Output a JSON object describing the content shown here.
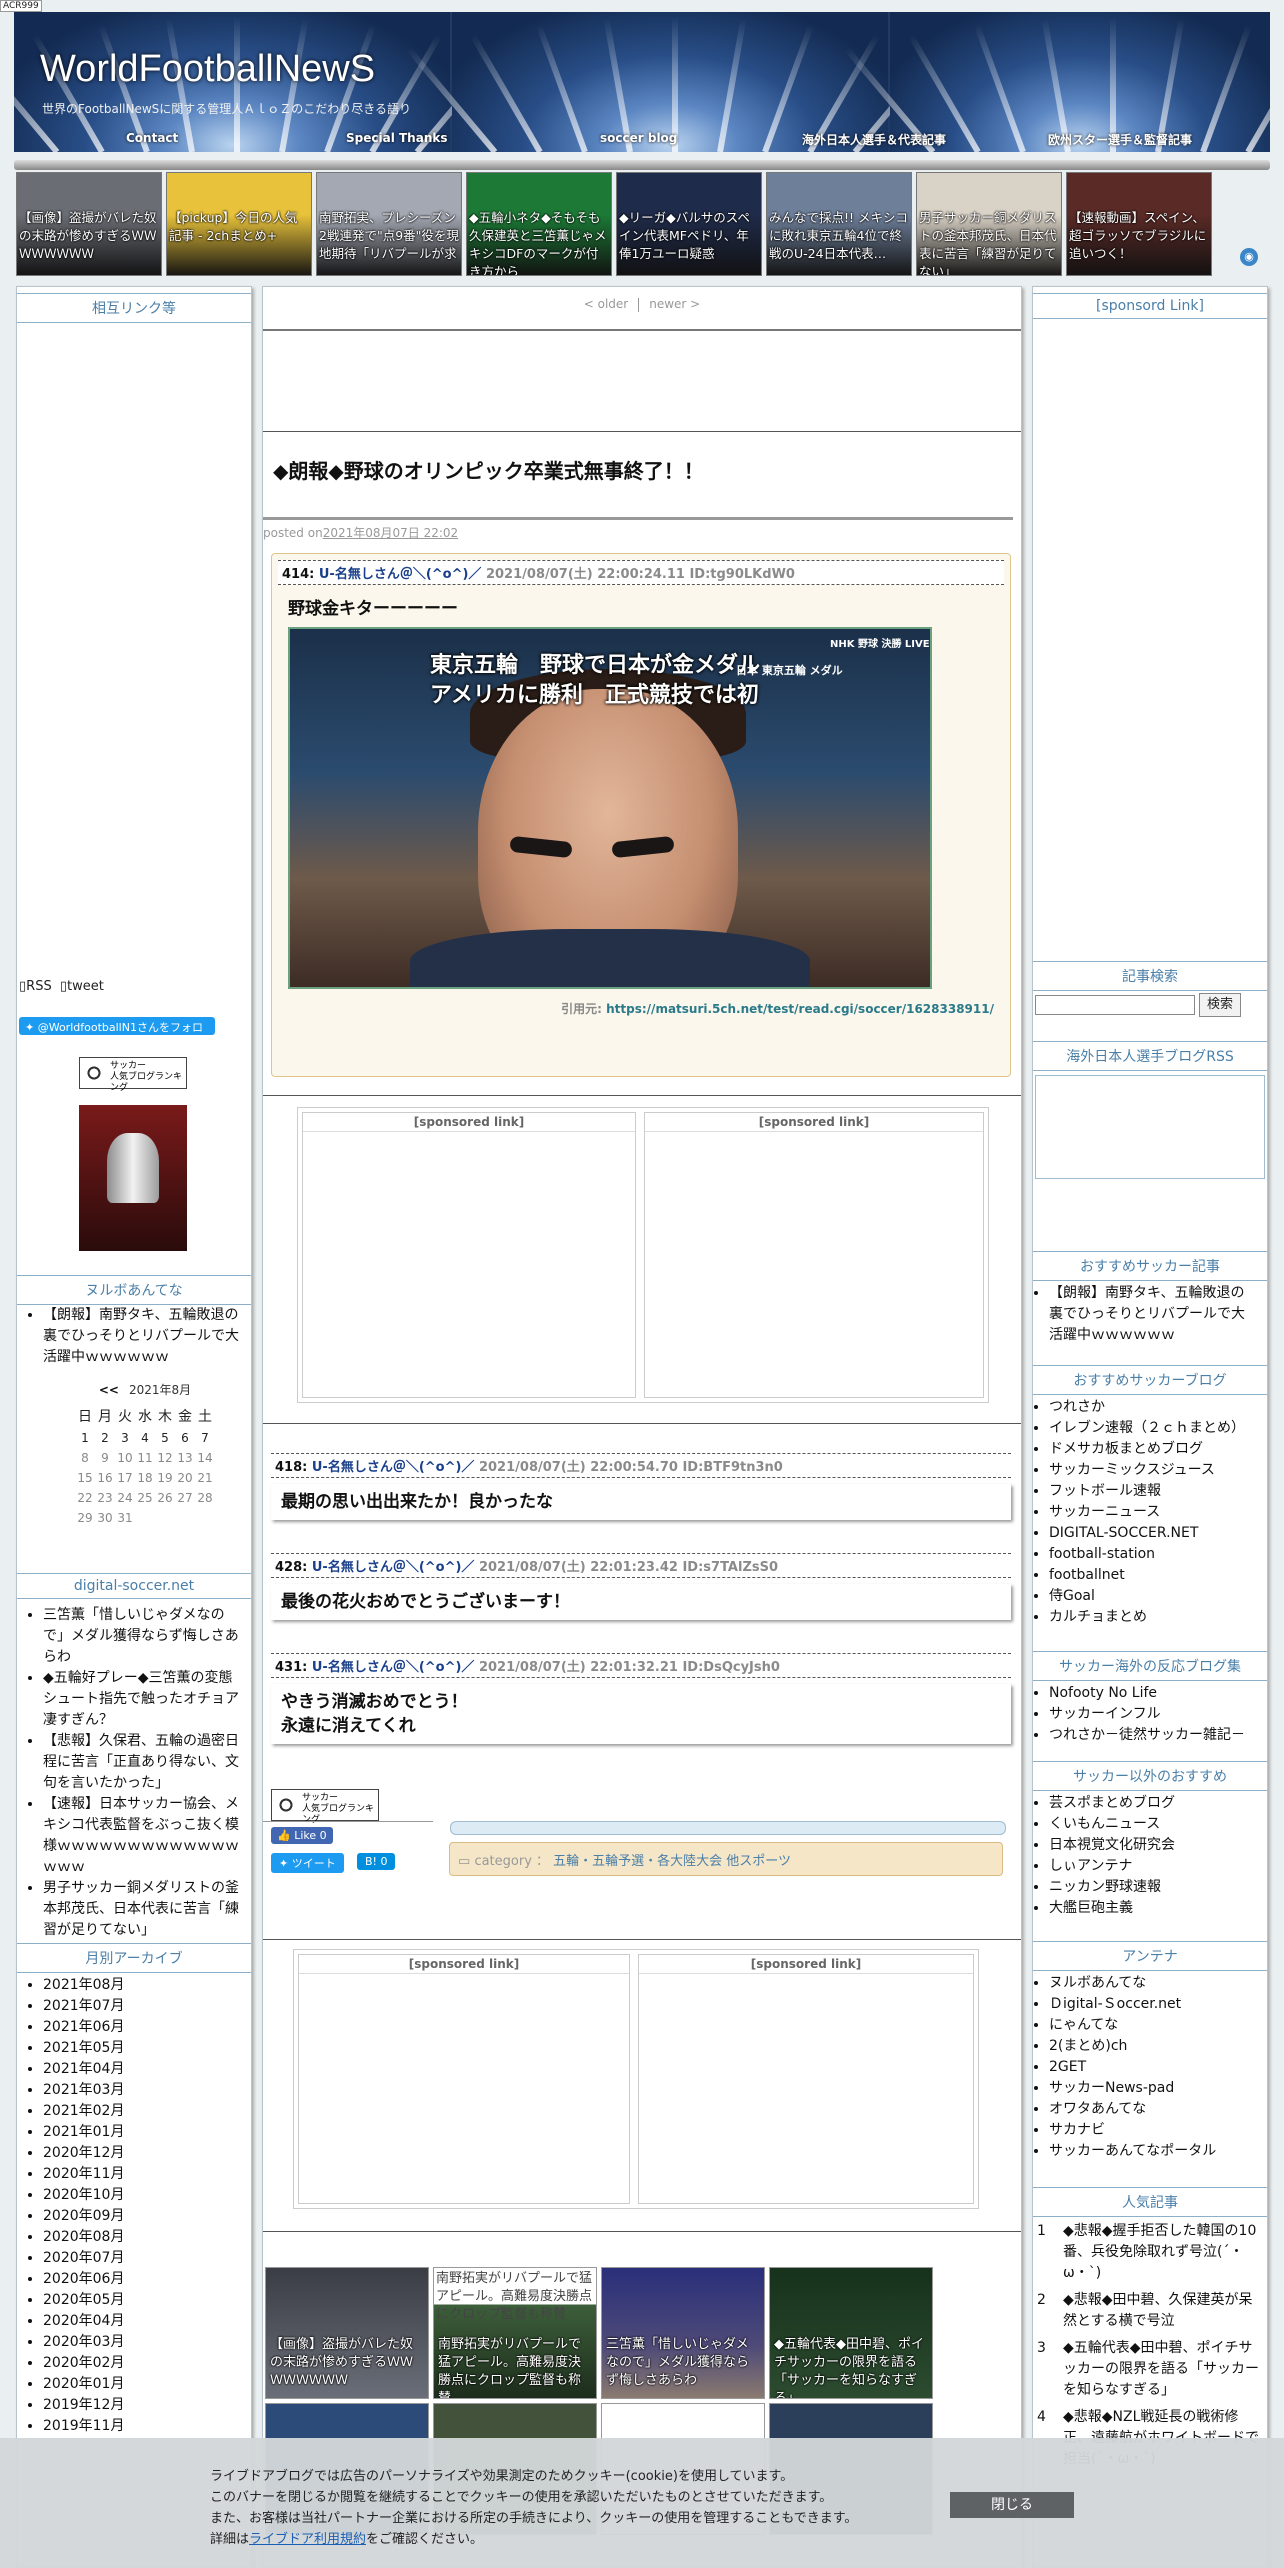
{
  "corner_tag": "ACR999",
  "header": {
    "title": "WorldFootballNewS",
    "subtitle": "世界のFootballNewSに関する管理人ＡｌｏＺのこだわり尽きる語り",
    "nav": [
      "Contact",
      "Special Thanks",
      "soccer blog",
      "海外日本人選手＆代表記事",
      "欧州スター選手＆監督記事"
    ]
  },
  "top_strip": [
    "【画像】盗撮がバレた奴の末路が惨めすぎるＷＷＷＷＷＷＷＷ",
    "【pickup】今日の人気記事 - 2chまとめ+",
    "南野拓実、プレシーズン2戦連発で\"点9番\"役を現地期待「リバプールが求",
    "◆五輪小ネタ◆そもそも久保建英と三笘薫じゃメキシコDFのマークが付き方から",
    "◆リーガ◆バルサのスペイン代表MFペドリ、年俸1万ユーロ疑惑",
    "みんなで採点!! メキシコに敗れ東京五輪4位で終戦のU-24日本代表…",
    "男子サッカー銅メダリストの釜本邦茂氏、日本代表に苦言「練習が足りてない」",
    "【速報動画】スペイン、超ゴラッソでブラジルに追いつく！"
  ],
  "left": {
    "mutual_links_h": "相互リンク等",
    "rss_alt": "RSS",
    "tweet_alt": "tweet",
    "follow_btn": "@WorldfootballN1さんをフォロー",
    "rank_badge": "サッカー\n人気ブログランキング",
    "nuruboantena_h": "ヌルボあんてな",
    "nuruboantena_items": [
      "【朗報】南野タキ、五輪敗退の裏でひっそりとリバプールで大活躍中ｗｗｗｗｗｗ"
    ],
    "calendar": {
      "prev": "<<",
      "month": "2021年8月",
      "weekdays": [
        "日",
        "月",
        "火",
        "水",
        "木",
        "金",
        "土"
      ],
      "rows": [
        [
          "1",
          "2",
          "3",
          "4",
          "5",
          "6",
          "7"
        ],
        [
          "8",
          "9",
          "10",
          "11",
          "12",
          "13",
          "14"
        ],
        [
          "15",
          "16",
          "17",
          "18",
          "19",
          "20",
          "21"
        ],
        [
          "22",
          "23",
          "24",
          "25",
          "26",
          "27",
          "28"
        ],
        [
          "29",
          "30",
          "31",
          "",
          "",
          "",
          ""
        ]
      ]
    },
    "digital_h": "digital-soccer.net",
    "digital_items": [
      "三笘薫「惜しいじゃダメなので」メダル獲得ならず悔しさあらわ",
      "◆五輪好プレー◆三笘薫の変態シュート指先で触ったオチョア凄すぎん？",
      "【悲報】久保君、五輪の過密日程に苦言「正直あり得ない、文句を言いたかった」",
      "【速報】日本サッカー協会、メキシコ代表監督をぶっこ抜く模様ｗｗｗｗｗｗｗｗｗｗｗｗｗｗｗｗ",
      "男子サッカー銅メダリストの釜本邦茂氏、日本代表に苦言「練習が足りてない」"
    ],
    "archive_h": "月別アーカイブ",
    "archive": [
      "2021年08月",
      "2021年07月",
      "2021年06月",
      "2021年05月",
      "2021年04月",
      "2021年03月",
      "2021年02月",
      "2021年01月",
      "2020年12月",
      "2020年11月",
      "2020年10月",
      "2020年09月",
      "2020年08月",
      "2020年07月",
      "2020年06月",
      "2020年05月",
      "2020年04月",
      "2020年03月",
      "2020年02月",
      "2020年01月",
      "2019年12月",
      "2019年11月"
    ]
  },
  "main": {
    "pager_older": "< older",
    "pager_newer": "newer >",
    "title": "◆朗報◆野球のオリンピック卒業式無事終了！！",
    "posted_prefix": "posted on",
    "posted_date": "2021年08月07日 22:02",
    "responses": [
      {
        "num": "414:",
        "name": "U-名無しさん＠＼(^o^)／",
        "meta": "2021/08/07(土) 22:00:24.11 ID:tg90LKdW0",
        "body": "野球金キターーーーー"
      },
      {
        "num": "418:",
        "name": "U-名無しさん＠＼(^o^)／",
        "meta": "2021/08/07(土) 22:00:54.70 ID:BTF9tn3n0",
        "body": "最期の思い出出来たか！良かったな"
      },
      {
        "num": "428:",
        "name": "U-名無しさん＠＼(^o^)／",
        "meta": "2021/08/07(土) 22:01:23.42 ID:s7TAlZsS0",
        "body": "最後の花火おめでとうございまーす！"
      },
      {
        "num": "431:",
        "name": "U-名無しさん＠＼(^o^)／",
        "meta": "2021/08/07(土) 22:01:32.21 ID:DsQcyJsh0",
        "body": "やきう消滅おめでとう！\n永遠に消えてくれ"
      }
    ],
    "tv_caption_1": "東京五輪　野球で日本が金メダル",
    "tv_caption_2": "アメリカに勝利　正式競技では初",
    "tv_logo": "日本 東京五輪 メダル",
    "tv_nhk": "NHK 野球 決勝 LIVE",
    "cite_prefix": "引用元: ",
    "cite_url": "https://matsuri.5ch.net/test/read.cgi/soccer/1628338911/",
    "sponsored": "[sponsored link]",
    "like": "Like 0",
    "tweet": "ツイート",
    "hatena": "B! 0",
    "category_label": "category ：",
    "category_link": "五輪・五輪予選・各大陸大会 他スポーツ",
    "bottom_thumbs": [
      {
        "cap": "【画像】盗撮がバレた奴の末路が惨めすぎるＷＷＷＷＷＷＷＷ"
      },
      {
        "alt": "南野拓実がリバプールで猛アピール。高難易度決勝点にクロップ監督も称賛",
        "cap": "南野拓実がリバプールで猛アピール。高難易度決勝点にクロップ監督も称賛"
      },
      {
        "cap": "三笘薫「惜しいじゃダメなので」メダル獲得ならず悔しさあらわ"
      },
      {
        "cap": "◆五輪代表◆田中碧、ポイチサッカーの限界を語る「サッカーを知らなすぎる」"
      }
    ]
  },
  "right": {
    "sponsored_h": "[sponsord Link]",
    "search_h": "記事検索",
    "search_btn": "検索",
    "rss_h": "海外日本人選手ブログRSS",
    "osusume_article_h": "おすすめサッカー記事",
    "osusume_article": [
      "【朗報】南野タキ、五輪敗退の裏でひっそりとリバプールで大活躍中ｗｗｗｗｗｗ"
    ],
    "osusume_blog_h": "おすすめサッカーブログ",
    "osusume_blog": [
      "つれさか",
      "イレブン速報（２ｃｈまとめ）",
      "ドメサカ板まとめブログ",
      "サッカーミックスジュース",
      "フットボール速報",
      "サッカーニュース",
      "DIGITAL-SOCCER.NET",
      "football-station",
      "footballnet",
      "侍Goal",
      "カルチョまとめ"
    ],
    "hannou_h": "サッカー海外の反応ブログ集",
    "hannou": [
      "Nofooty No Life",
      "サッカーインフル",
      "つれさか－徒然サッカー雑記－"
    ],
    "other_h": "サッカー以外のおすすめ",
    "other": [
      "芸スポまとめブログ",
      "くいもんニュース",
      "日本視覚文化研究会",
      "しぃアンテナ",
      "ニッカン野球速報",
      "大艦巨砲主義"
    ],
    "antenna_h": "アンテナ",
    "antenna": [
      "ヌルボあんてな",
      "Ｄigital-Ｓoccer.net",
      "にゃんてな",
      "2(まとめ)ch",
      "2GET",
      "サッカーNews-pad",
      "オワタあんてな",
      "サカナビ",
      "サッカーあんてなポータル"
    ],
    "popular_h": "人気記事",
    "popular": [
      "◆悲報◆握手拒否した韓国の10番、兵役免除取れず号泣(´・ω・`)",
      "◆悲報◆田中碧、久保建英が呆然とする横で号泣",
      "◆五輪代表◆田中碧、ポイチサッカーの限界を語る「サッカーを知らなすぎる」",
      "◆悲報◆NZL戦延長の戦術修正、遠藤航がホワイトボードで担当(´・ω・`)"
    ]
  },
  "cookie": {
    "lines": [
      "ライブドアブログでは広告のパーソナライズや効果測定のためクッキー(cookie)を使用しています。",
      "このバナーを閉じるか閲覧を継続することでクッキーの使用を承認いただいたものとさせていただきます。",
      "また、お客様は当社パートナー企業における所定の手続きにより、クッキーの使用を管理することもできます。"
    ],
    "last_pre": "詳細は",
    "last_link": "ライブドア利用規約",
    "last_post": "をご確認ください。",
    "close": "閉じる"
  }
}
